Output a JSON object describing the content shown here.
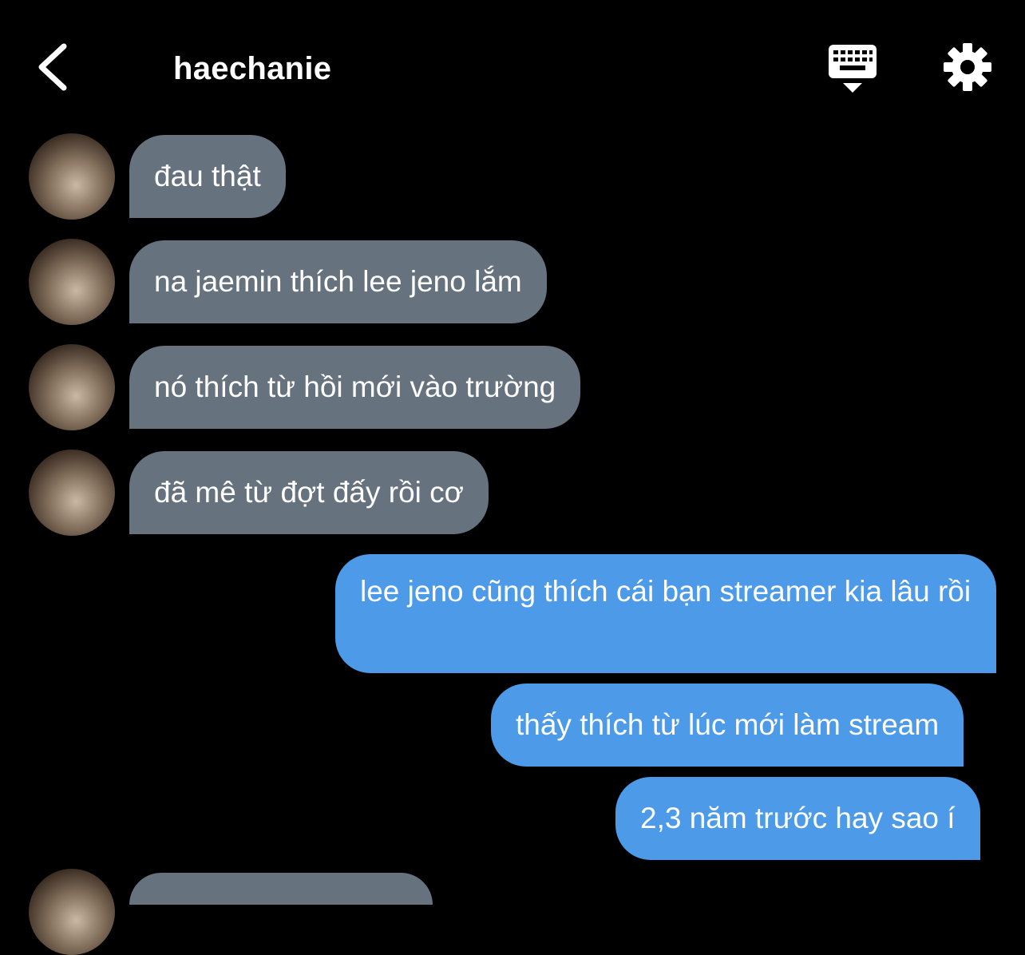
{
  "header": {
    "title": "haechanie",
    "back_icon": "chevron-left-icon",
    "keyboard_icon": "keyboard-hide-icon",
    "settings_icon": "gear-icon"
  },
  "colors": {
    "background": "#000000",
    "incoming_bubble": "#67727f",
    "outgoing_bubble": "#4c9ae8",
    "text": "#ffffff"
  },
  "messages": [
    {
      "direction": "incoming",
      "text": "đau thật"
    },
    {
      "direction": "incoming",
      "text": "na jaemin thích lee jeno lắm"
    },
    {
      "direction": "incoming",
      "text": "nó thích từ hồi mới vào trường"
    },
    {
      "direction": "incoming",
      "text": "đã mê từ đợt đấy rồi cơ"
    },
    {
      "direction": "outgoing",
      "text": "lee jeno cũng thích cái bạn streamer kia lâu rồi"
    },
    {
      "direction": "outgoing",
      "text": "thấy thích từ lúc mới làm stream"
    },
    {
      "direction": "outgoing",
      "text": "2,3 năm trước hay sao í"
    }
  ]
}
